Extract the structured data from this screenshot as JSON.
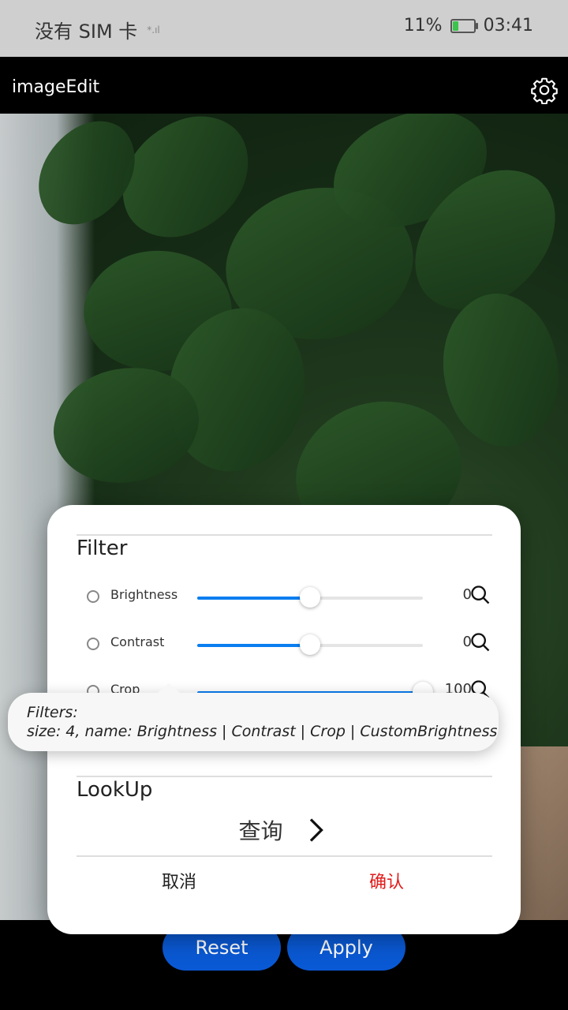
{
  "status_bar": {
    "carrier": "没有 SIM 卡",
    "battery": "11%",
    "time": "03:41"
  },
  "app": {
    "title": "imageEdit"
  },
  "dialog": {
    "filter_title": "Filter",
    "filters": [
      {
        "name": "Brightness",
        "value": "0",
        "level": 0.5
      },
      {
        "name": "Contrast",
        "value": "0",
        "level": 0.5
      },
      {
        "name": "Crop",
        "value": "100",
        "level": 1.0
      }
    ],
    "lookup_title": "LookUp",
    "lookup_label": "查询",
    "cancel": "取消",
    "confirm": "确认"
  },
  "tooltip": {
    "line1": "Filters:",
    "line2": "size: 4, name: Brightness | Contrast | Crop | CustomBrightness"
  },
  "buttons": {
    "reset": "Reset",
    "apply": "Apply"
  },
  "colors": {
    "accent": "#0a59d4",
    "slider": "#0a7ef0",
    "confirm": "#e21b1b"
  }
}
